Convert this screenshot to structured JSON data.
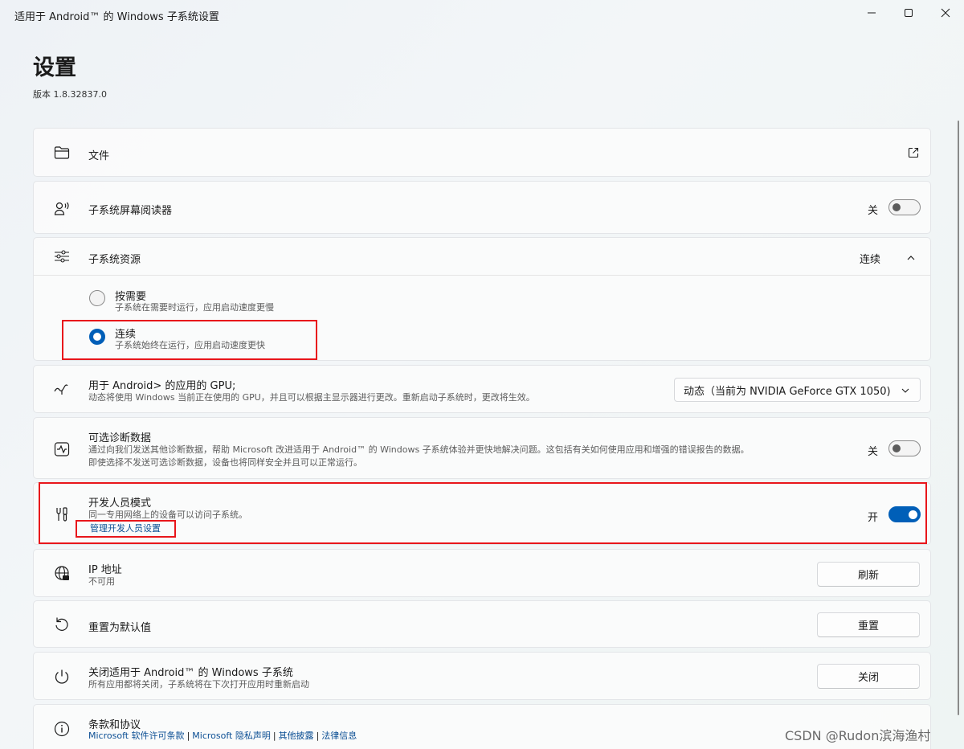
{
  "window": {
    "title": "适用于 Android™ 的 Windows 子系统设置",
    "controls": [
      "minimize-icon",
      "maximize-icon",
      "close-icon"
    ]
  },
  "page": {
    "title": "设置",
    "version": "版本 1.8.32837.0"
  },
  "files": {
    "title": "文件",
    "icon": "folder-icon",
    "action_icon": "open-external-icon"
  },
  "screen_reader": {
    "title": "子系统屏幕阅读器",
    "state": "关",
    "toggle_on": false,
    "icon": "screen-reader-icon"
  },
  "resources": {
    "title": "子系统资源",
    "value": "连续",
    "icon": "sliders-icon",
    "options": [
      {
        "label": "按需要",
        "desc": "子系统在需要时运行，应用启动速度更慢",
        "checked": false
      },
      {
        "label": "连续",
        "desc": "子系统始终在运行，应用启动速度更快",
        "checked": true
      }
    ]
  },
  "gpu": {
    "title": "用于 Android> 的应用的 GPU;",
    "desc": "动态将使用 Windows 当前正在使用的 GPU，并且可以根据主显示器进行更改。重新启动子系统时，更改将生效。",
    "selected": "动态（当前为 NVIDIA GeForce GTX 1050)",
    "icon": "gpu-icon"
  },
  "diagnostics": {
    "title": "可选诊断数据",
    "desc1": "通过向我们发送其他诊断数据，帮助 Microsoft 改进适用于 Android™ 的 Windows 子系统体验并更快地解决问题。这包括有关如何使用应用和增强的错误报告的数据。",
    "desc2": "即使选择不发送可选诊断数据，设备也将同样安全并且可以正常运行。",
    "state": "关",
    "toggle_on": false,
    "icon": "pulse-icon"
  },
  "developer": {
    "title": "开发人员模式",
    "desc": "同一专用网络上的设备可以访问子系统。",
    "link": "管理开发人员设置",
    "state": "开",
    "toggle_on": true,
    "icon": "tools-icon"
  },
  "ip": {
    "title": "IP 地址",
    "desc": "不可用",
    "button": "刷新",
    "icon": "globe-icon"
  },
  "reset": {
    "title": "重置为默认值",
    "button": "重置",
    "icon": "reset-icon"
  },
  "shutdown": {
    "title": "关闭适用于 Android™ 的 Windows 子系统",
    "desc": "所有应用都将关闭，子系统将在下次打开应用时重新启动",
    "button": "关闭",
    "icon": "power-icon"
  },
  "terms": {
    "title": "条款和协议",
    "links": [
      "Microsoft 软件许可条款",
      "Microsoft 隐私声明",
      "其他披露",
      "法律信息"
    ],
    "icon": "info-icon"
  },
  "watermark": "CSDN @Rudon滨海渔村",
  "colors": {
    "accent": "#005fb8",
    "highlight": "#e8161b",
    "link": "#0c4f94"
  }
}
